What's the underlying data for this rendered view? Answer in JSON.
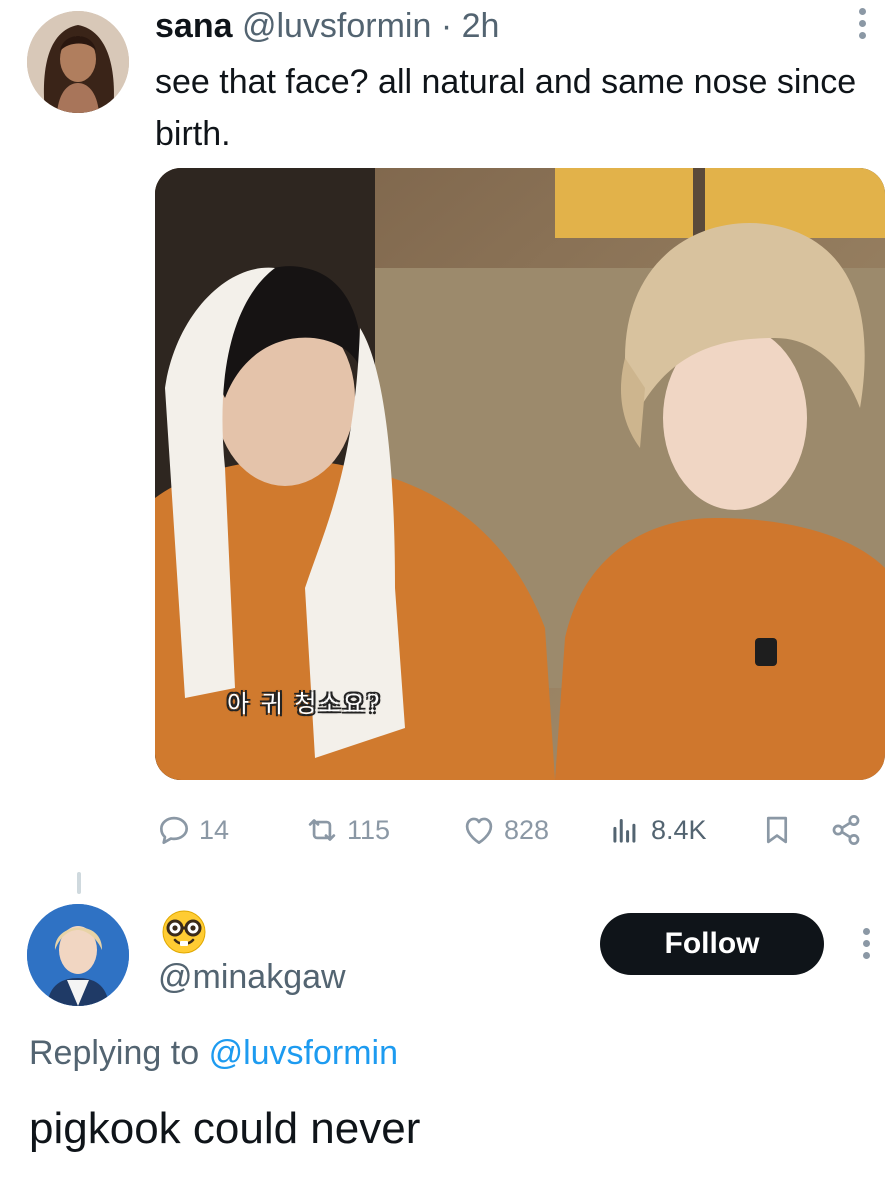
{
  "tweet": {
    "author_name": "sana",
    "author_handle": "@luvsformin",
    "separator": "·",
    "time": "2h",
    "text": "see that face? all natural and same nose since birth.",
    "image_caption": "아 귀 청소요?",
    "avatar_icon": "user-photo-icon",
    "more_icon": "vertical-dots-icon",
    "stats": {
      "replies": "14",
      "retweets": "115",
      "likes": "828",
      "views": "8.4K"
    }
  },
  "reply": {
    "display_name_emoji": "🤓",
    "author_handle": "@minakgaw",
    "follow_label": "Follow",
    "replying_prefix": "Replying to",
    "replying_to": "@luvsformin",
    "text": "pigkook could never"
  },
  "colors": {
    "text_primary": "#0f1419",
    "text_secondary": "#536471",
    "icon_muted": "#8b98a5",
    "link": "#1d9bf0",
    "follow_button_bg": "#0f1419",
    "follow_button_text": "#ffffff"
  }
}
